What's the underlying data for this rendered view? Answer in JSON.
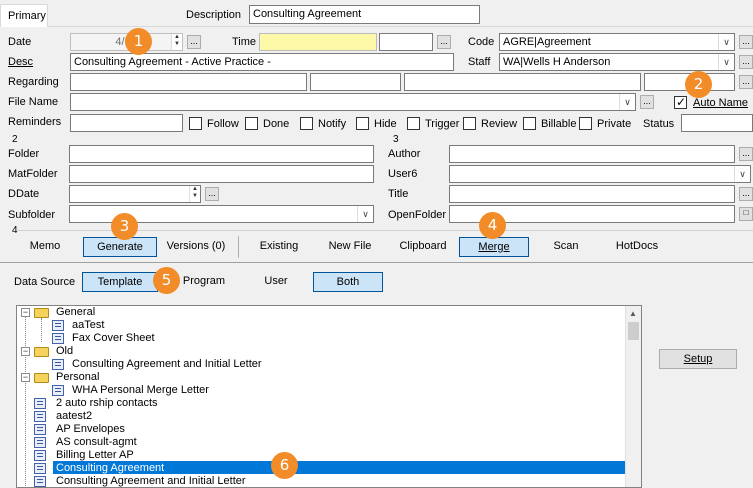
{
  "tabs": {
    "primary": "Primary"
  },
  "description": {
    "label": "Description",
    "value": "Consulting Agreement"
  },
  "date": {
    "label": "Date",
    "value": "4/30/2"
  },
  "time": {
    "label": "Time",
    "value": ""
  },
  "code": {
    "label": "Code",
    "value": "AGRE|Agreement"
  },
  "desc": {
    "label": "Desc",
    "value": "Consulting Agreement - Active Practice -"
  },
  "staff": {
    "label": "Staff",
    "value": "WA|Wells H Anderson"
  },
  "regarding": {
    "label": "Regarding"
  },
  "file_name": {
    "label": "File Name"
  },
  "auto_name": {
    "label": "Auto Name",
    "checked": true
  },
  "reminders": {
    "label": "Reminders",
    "checkboxes": [
      "Follow",
      "Done",
      "Notify",
      "Hide",
      "Trigger",
      "Review",
      "Billable",
      "Private"
    ]
  },
  "status": {
    "label": "Status"
  },
  "section_numbers": {
    "left": "2",
    "right": "3",
    "bottom": "4"
  },
  "left_fields": [
    "Folder",
    "MatFolder",
    "DDate",
    "Subfolder"
  ],
  "right_fields": [
    "Author",
    "User6",
    "Title",
    "OpenFolder"
  ],
  "action_tabs": [
    "Memo",
    "Generate",
    "Versions (0)",
    "Existing",
    "New File",
    "Clipboard",
    "Merge",
    "Scan",
    "HotDocs"
  ],
  "data_source": {
    "label": "Data Source",
    "options": [
      "Template",
      "Program",
      "User",
      "Both"
    ]
  },
  "tree": {
    "folders": [
      {
        "name": "General",
        "children": [
          "aaTest",
          "Fax Cover Sheet"
        ]
      },
      {
        "name": "Old",
        "children": [
          "Consulting Agreement and Initial Letter"
        ]
      },
      {
        "name": "Personal",
        "children": [
          "WHA Personal Merge Letter"
        ]
      }
    ],
    "items": [
      "2 auto rship contacts",
      "aatest2",
      "AP Envelopes",
      "AS consult-agmt",
      "Billing Letter AP",
      "Consulting Agreement",
      "Consulting Agreement and Initial Letter"
    ],
    "selected": "Consulting Agreement"
  },
  "setup_button": "Setup",
  "badges": [
    "1",
    "2",
    "3",
    "4",
    "5",
    "6"
  ],
  "colors": {
    "badge": "#f28c28",
    "selection": "#0078d7",
    "selected_button": "#cce4f7"
  }
}
